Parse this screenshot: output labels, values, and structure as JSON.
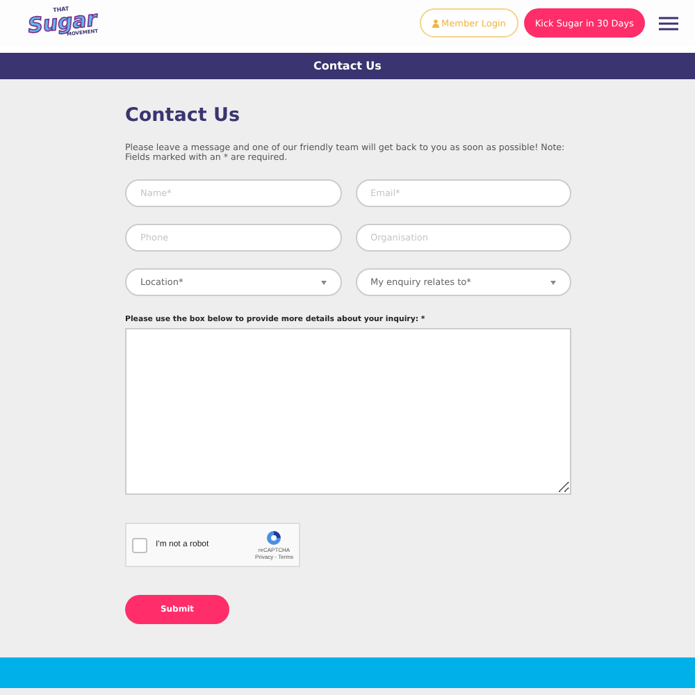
{
  "header": {
    "logo": {
      "top": "THAT",
      "main": "Sugar",
      "bottom": "MOVEMENT"
    },
    "login_button": "Member Login",
    "cta_button": "Kick Sugar in 30 Days"
  },
  "banner": {
    "title": "Contact Us"
  },
  "form": {
    "heading": "Contact Us",
    "intro": "Please leave a message and one of our friendly team will get back to you as soon as possible! Note: Fields marked with an * are required.",
    "fields": [
      {
        "kind": "text",
        "placeholder": "Name*"
      },
      {
        "kind": "text",
        "placeholder": "Email*"
      },
      {
        "kind": "text",
        "placeholder": "Phone"
      },
      {
        "kind": "text",
        "placeholder": "Organisation"
      },
      {
        "kind": "select",
        "label": "Location*"
      },
      {
        "kind": "select",
        "label": "My enquiry relates to*"
      }
    ],
    "details_label": "Please use the box below to provide more details about your inquiry: *",
    "captcha": {
      "label": "I'm not a robot",
      "checked": false,
      "brand": "reCAPTCHA",
      "links": "Privacy - Terms"
    },
    "submit": "Submit"
  }
}
